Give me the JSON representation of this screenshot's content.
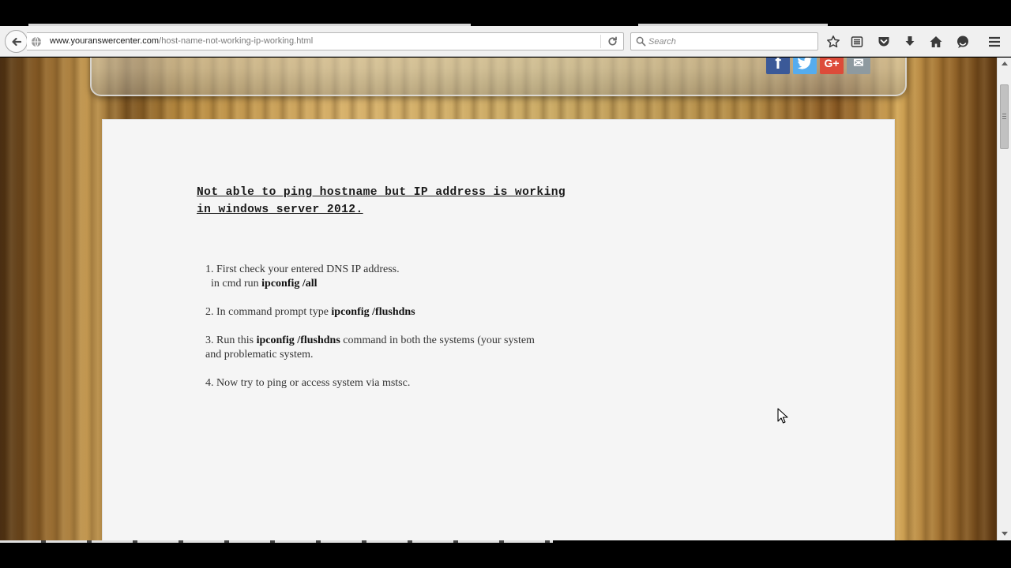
{
  "browser": {
    "url_domain": "www.youranswercenter.com",
    "url_path": "/host-name-not-working-ip-working.html",
    "search_placeholder": "Search",
    "icons": [
      "back-arrow-icon",
      "globe-icon",
      "reload-icon",
      "search-icon",
      "bookmark-star-icon",
      "reading-list-icon",
      "pocket-icon",
      "download-icon",
      "home-icon",
      "chat-icon",
      "menu-icon"
    ]
  },
  "header": {
    "social": {
      "facebook": "f",
      "twitter": "t",
      "googleplus": "G+",
      "email": "✉"
    }
  },
  "article": {
    "title_line1": "Not able to ping hostname but IP address is working",
    "title_line2": "in windows server 2012.",
    "steps": [
      {
        "pre": "1. First check your entered DNS IP address.",
        "line2_pre": "in cmd run ",
        "line2_bold": "ipconfig /all"
      },
      {
        "pre": "2. In command prompt type ",
        "bold": "ipconfig /flushdns"
      },
      {
        "pre": "3. Run this ",
        "bold": "ipconfig /flushdns",
        "post": " command in both the systems (your system",
        "line2": "and problematic system."
      },
      {
        "pre": "4. Now try to ping  or access system via mstsc."
      }
    ]
  },
  "colors": {
    "facebook": "#3b5998",
    "twitter": "#55acee",
    "googleplus": "#dd4b39",
    "email": "#8e9aa0",
    "content_bg": "#f5f5f5"
  }
}
